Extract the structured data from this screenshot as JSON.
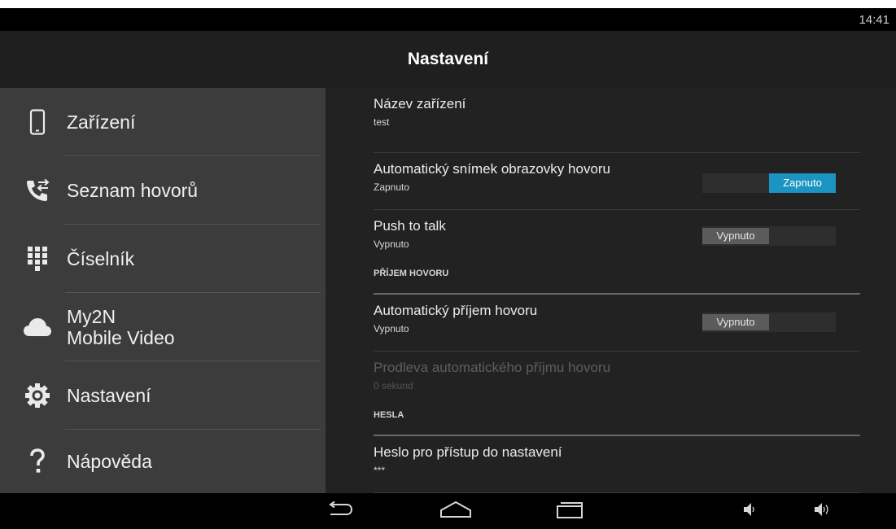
{
  "status_bar": {
    "time": "14:41"
  },
  "action_bar": {
    "title": "Nastavení"
  },
  "sidebar": {
    "items": [
      {
        "label": "Zařízení",
        "icon": "phone-icon"
      },
      {
        "label": "Seznam hovorů",
        "icon": "call-log-icon"
      },
      {
        "label": "Číselník",
        "icon": "dialpad-icon"
      },
      {
        "label": "My2N\nMobile Video",
        "icon": "cloud-icon"
      },
      {
        "label": "Nastavení",
        "icon": "gear-icon"
      },
      {
        "label": "Nápověda",
        "icon": "help-icon"
      }
    ]
  },
  "settings": {
    "device_name": {
      "title": "Název zařízení",
      "summary": "test"
    },
    "auto_snapshot": {
      "title": "Automatický snímek obrazovky hovoru",
      "summary": "Zapnuto",
      "toggle": "Zapnuto",
      "enabled": true
    },
    "push_to_talk": {
      "title": "Push to talk",
      "summary": "Vypnuto",
      "toggle": "Vypnuto",
      "enabled": false
    },
    "section_incoming": "PŘÍJEM HOVORU",
    "auto_answer": {
      "title": "Automatický příjem hovoru",
      "summary": "Vypnuto",
      "toggle": "Vypnuto",
      "enabled": false
    },
    "auto_answer_delay": {
      "title": "Prodleva automatického příjmu hovoru",
      "summary": "0 sekund",
      "disabled": true
    },
    "section_passwords": "HESLA",
    "settings_password": {
      "title": "Heslo pro přístup do nastavení",
      "summary": "***"
    }
  },
  "navbar": {
    "icons": [
      "back-icon",
      "home-icon",
      "recent-apps-icon",
      "volume-down-icon",
      "volume-up-icon"
    ]
  },
  "colors": {
    "accent": "#1a95c2",
    "sidebar_bg": "#3c3c3c",
    "content_bg": "#222222",
    "action_bar_bg": "#1f1f1f"
  }
}
